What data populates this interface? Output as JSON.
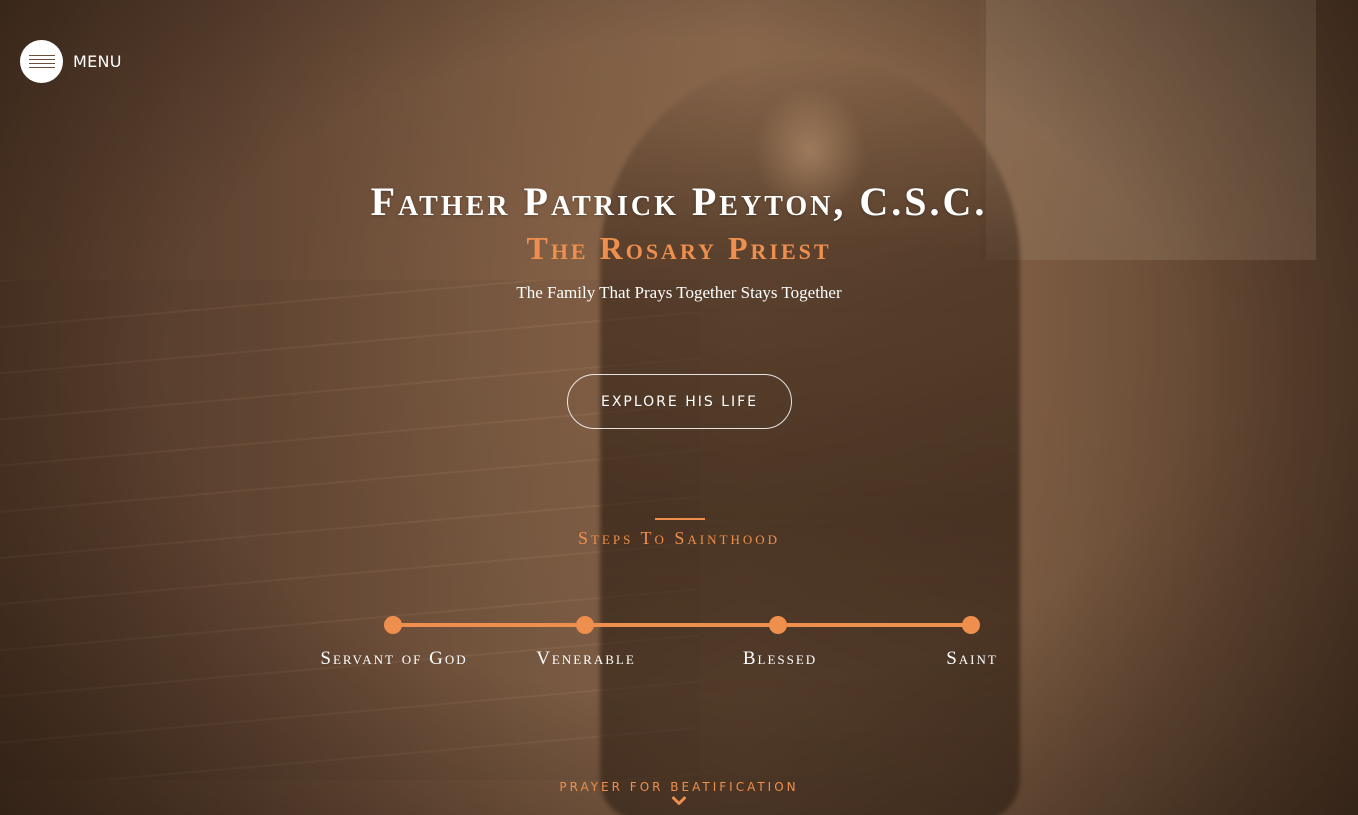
{
  "menu": {
    "label": "MENU"
  },
  "hero": {
    "title": "Father Patrick Peyton, C.S.C.",
    "subtitle": "The Rosary Priest",
    "tagline": "The Family That Prays Together Stays Together",
    "cta_label": "EXPLORE HIS LIFE"
  },
  "steps": {
    "heading": "Steps To Sainthood",
    "stages": [
      {
        "label": "Servant of God"
      },
      {
        "label": "Venerable"
      },
      {
        "label": "Blessed"
      },
      {
        "label": "Saint"
      }
    ]
  },
  "footer": {
    "prayer_link": "PRAYER FOR BEATIFICATION"
  },
  "colors": {
    "accent": "#ef8f4d",
    "text": "#ffffff",
    "background": "#7a5d45"
  },
  "icons": {
    "menu": "hamburger-icon",
    "scroll": "chevron-down-icon"
  }
}
